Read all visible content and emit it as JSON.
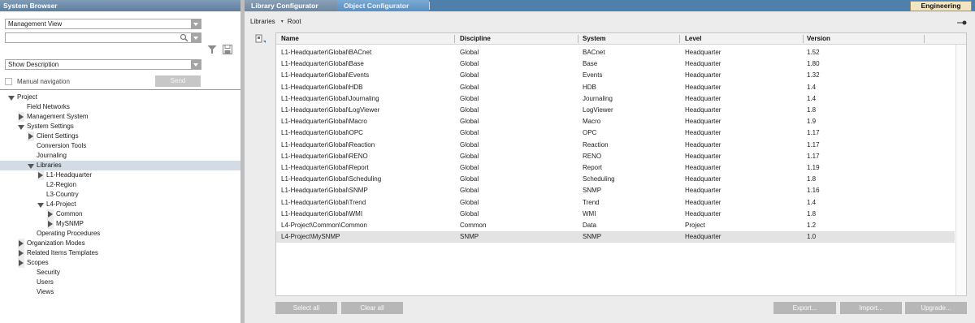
{
  "system_browser": {
    "title": "System Browser",
    "view_select": "Management View",
    "search_value": "",
    "description_select": "Show Description",
    "manual_navigation_label": "Manual navigation",
    "send_label": "Send",
    "tree": [
      {
        "label": "Project",
        "level": 0,
        "toggle": "down"
      },
      {
        "label": "Field Networks",
        "level": 1,
        "toggle": "none"
      },
      {
        "label": "Management System",
        "level": 1,
        "toggle": "right"
      },
      {
        "label": "System Settings",
        "level": 1,
        "toggle": "down"
      },
      {
        "label": "Client Settings",
        "level": 2,
        "toggle": "right"
      },
      {
        "label": "Conversion Tools",
        "level": 2,
        "toggle": "none"
      },
      {
        "label": "Journaling",
        "level": 2,
        "toggle": "none"
      },
      {
        "label": "Libraries",
        "level": 2,
        "toggle": "down",
        "selected": true
      },
      {
        "label": "L1-Headquarter",
        "level": 3,
        "toggle": "right"
      },
      {
        "label": "L2-Region",
        "level": 3,
        "toggle": "none"
      },
      {
        "label": "L3-Country",
        "level": 3,
        "toggle": "none"
      },
      {
        "label": "L4-Project",
        "level": 3,
        "toggle": "down"
      },
      {
        "label": "Common",
        "level": 4,
        "toggle": "right"
      },
      {
        "label": "MySNMP",
        "level": 4,
        "toggle": "right"
      },
      {
        "label": "Operating Procedures",
        "level": 2,
        "toggle": "none"
      },
      {
        "label": "Organization Modes",
        "level": 1,
        "toggle": "right"
      },
      {
        "label": "Related Items Templates",
        "level": 1,
        "toggle": "right"
      },
      {
        "label": "Scopes",
        "level": 1,
        "toggle": "right"
      },
      {
        "label": "Security",
        "level": 2,
        "toggle": "none"
      },
      {
        "label": "Users",
        "level": 2,
        "toggle": "none"
      },
      {
        "label": "Views",
        "level": 2,
        "toggle": "none"
      }
    ]
  },
  "library_configurator": {
    "tabs": [
      "Library Configurator",
      "Object Configurator"
    ],
    "engineering_label": "Engineering",
    "breadcrumb": [
      "Libraries",
      "Root"
    ],
    "columns": [
      "Name",
      "Discipline",
      "System",
      "Level",
      "Version"
    ],
    "rows": [
      [
        "L1-Headquarter\\Global\\BACnet",
        "Global",
        "BACnet",
        "Headquarter",
        "1.52"
      ],
      [
        "L1-Headquarter\\Global\\Base",
        "Global",
        "Base",
        "Headquarter",
        "1.80"
      ],
      [
        "L1-Headquarter\\Global\\Events",
        "Global",
        "Events",
        "Headquarter",
        "1.32"
      ],
      [
        "L1-Headquarter\\Global\\HDB",
        "Global",
        "HDB",
        "Headquarter",
        "1.4"
      ],
      [
        "L1-Headquarter\\Global\\Journaling",
        "Global",
        "Journaling",
        "Headquarter",
        "1.4"
      ],
      [
        "L1-Headquarter\\Global\\LogViewer",
        "Global",
        "LogViewer",
        "Headquarter",
        "1.8"
      ],
      [
        "L1-Headquarter\\Global\\Macro",
        "Global",
        "Macro",
        "Headquarter",
        "1.9"
      ],
      [
        "L1-Headquarter\\Global\\OPC",
        "Global",
        "OPC",
        "Headquarter",
        "1.17"
      ],
      [
        "L1-Headquarter\\Global\\Reaction",
        "Global",
        "Reaction",
        "Headquarter",
        "1.17"
      ],
      [
        "L1-Headquarter\\Global\\RENO",
        "Global",
        "RENO",
        "Headquarter",
        "1.17"
      ],
      [
        "L1-Headquarter\\Global\\Report",
        "Global",
        "Report",
        "Headquarter",
        "1.19"
      ],
      [
        "L1-Headquarter\\Global\\Scheduling",
        "Global",
        "Scheduling",
        "Headquarter",
        "1.8"
      ],
      [
        "L1-Headquarter\\Global\\SNMP",
        "Global",
        "SNMP",
        "Headquarter",
        "1.16"
      ],
      [
        "L1-Headquarter\\Global\\Trend",
        "Global",
        "Trend",
        "Headquarter",
        "1.4"
      ],
      [
        "L1-Headquarter\\Global\\WMI",
        "Global",
        "WMI",
        "Headquarter",
        "1.8"
      ],
      [
        "L4-Project\\Common\\Common",
        "Common",
        "Data",
        "Project",
        "1.2"
      ],
      [
        "L4-Project\\MySNMP",
        "SNMP",
        "SNMP",
        "Headquarter",
        "1.0"
      ]
    ],
    "selected_row": 16,
    "buttons": {
      "select_all": "Select all",
      "clear_all": "Clear all",
      "export": "Export...",
      "import": "Import...",
      "upgrade": "Upgrade..."
    }
  },
  "colors": {
    "tab_bar": "#4f7fab",
    "engineering_bg": "#f3e4c2",
    "selection": "#d2dbe6"
  }
}
